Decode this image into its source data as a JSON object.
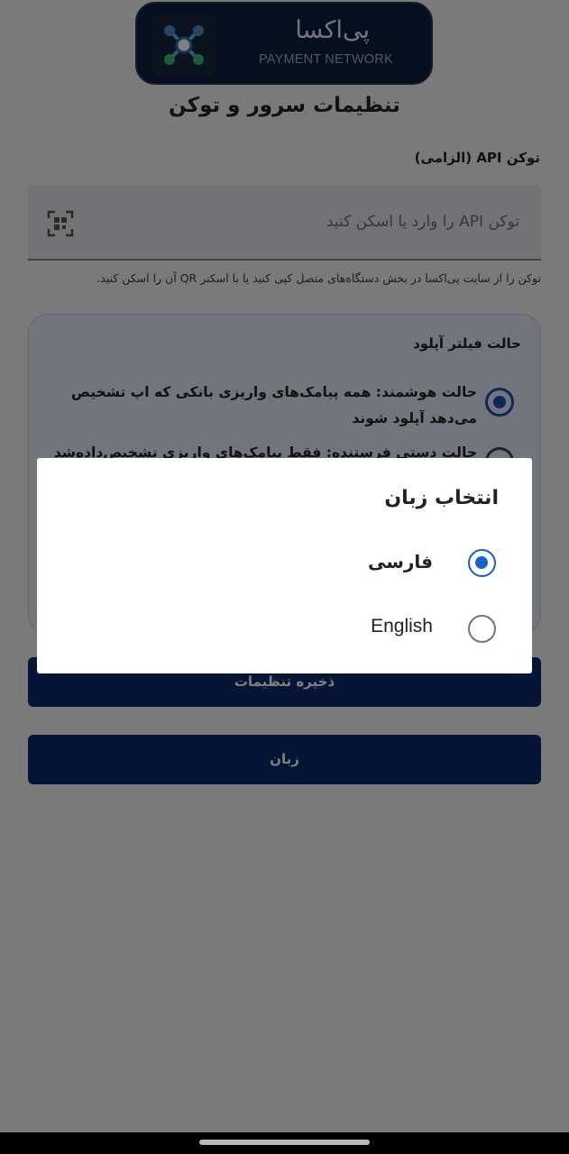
{
  "logo": {
    "name": "پی‌اکسا",
    "subtitle": "PAYMENT NETWORK"
  },
  "page": {
    "title": "تنظیمات سرور و توکن"
  },
  "token": {
    "label": "توکن API (الزامی)",
    "placeholder": "توکن API را وارد یا اسکن کنید",
    "helper": "توکن را از سایت پی‌اکسا در بخش دستگاه‌های متصل کپی کنید یا با اسکنر QR آن را اسکن کنید."
  },
  "filter": {
    "title": "حالت فیلتر آپلود",
    "options": [
      {
        "label": "حالت هوشمند: همه پیامک‌های واریزی بانکی که اپ تشخیص می‌دهد آپلود شوند",
        "selected": true
      },
      {
        "label": "حالت دستی فرستنده: فقط پیامک‌های واریزی تشخیص‌داده‌شده از",
        "selected": false
      }
    ]
  },
  "buttons": {
    "save": "ذخیره تنظیمات",
    "language": "زبان"
  },
  "dialog": {
    "title": "انتخاب زبان",
    "options": [
      {
        "label": "فارسی",
        "selected": true
      },
      {
        "label": "English",
        "selected": false
      }
    ]
  },
  "colors": {
    "primary": "#0d2a6a",
    "radio_accent": "#1565c0",
    "scrim": "rgba(0,0,0,0.5)"
  }
}
